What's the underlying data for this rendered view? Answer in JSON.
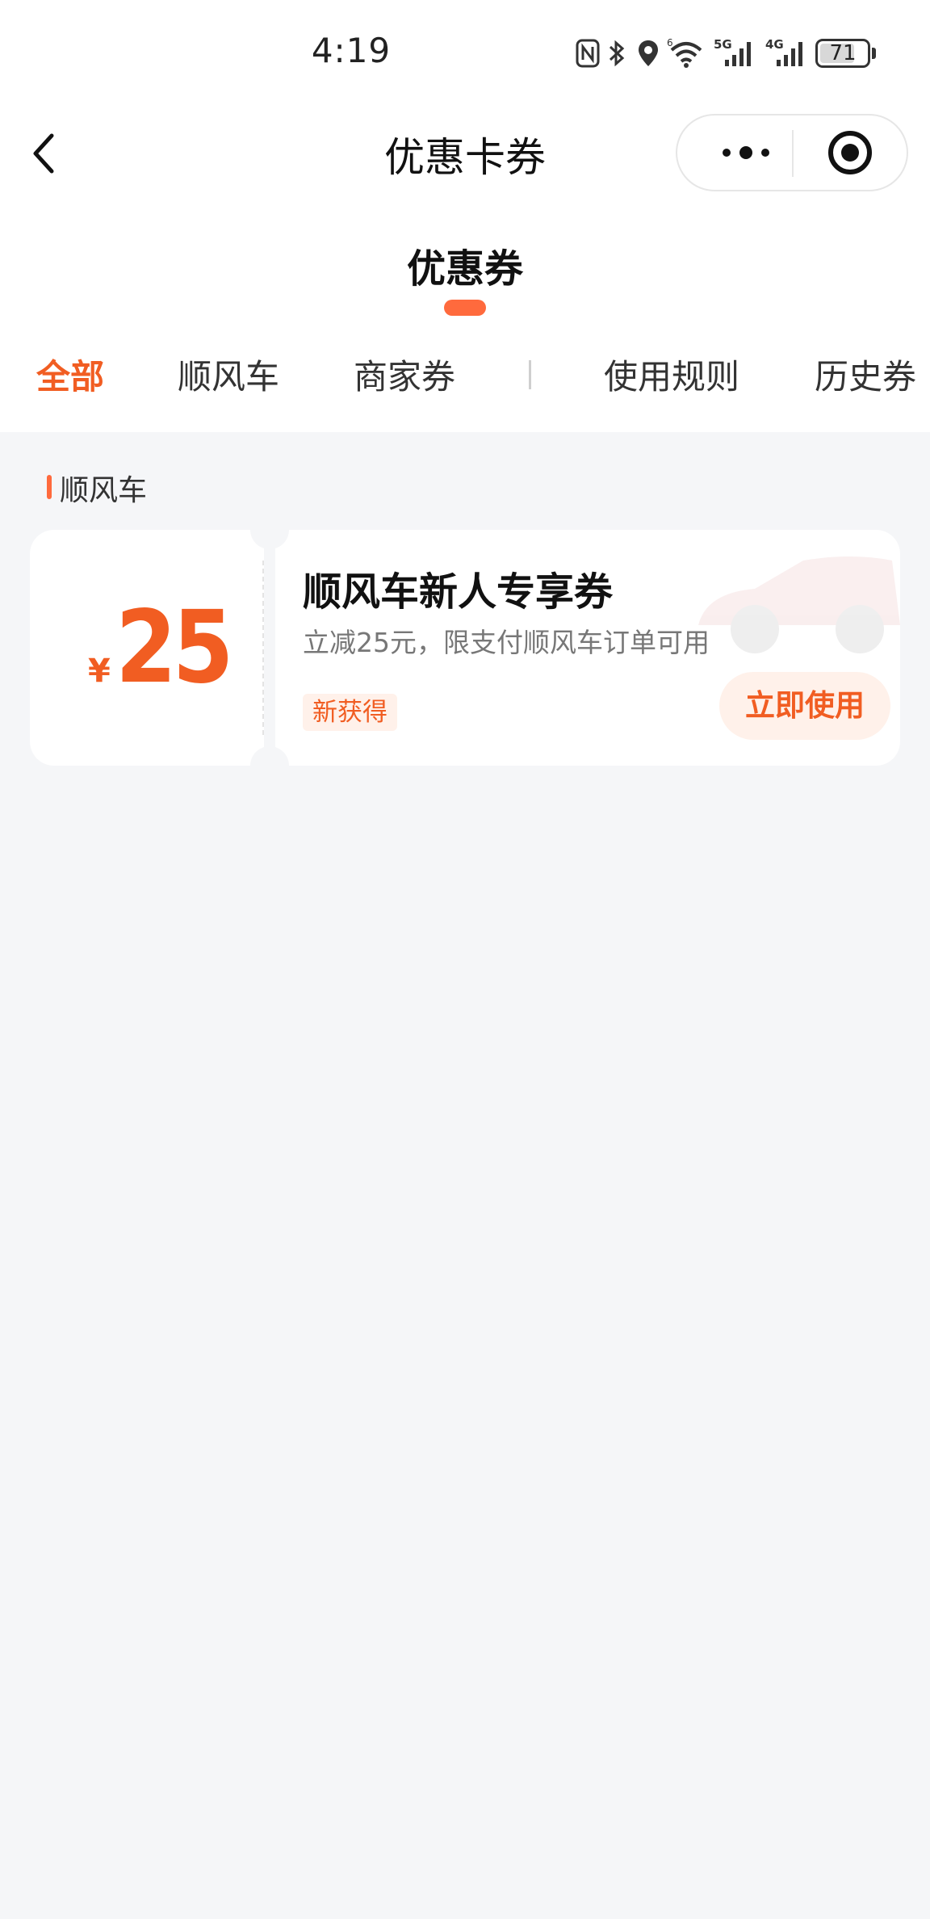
{
  "status_bar": {
    "time": "4:19",
    "battery": "71",
    "network_labels": [
      "5G",
      "4G"
    ],
    "icons": [
      "nfc-icon",
      "bluetooth-icon",
      "location-icon",
      "wifi-icon",
      "signal-5g-icon",
      "signal-4g-icon",
      "battery-icon"
    ]
  },
  "nav": {
    "title": "优惠卡券",
    "back_icon": "chevron-left-icon",
    "more_icon": "more-dots-icon",
    "close_icon": "target-circle-icon"
  },
  "page_tab": {
    "label": "优惠券",
    "accent_color": "#ff6a3d"
  },
  "filters": {
    "active_index": 0,
    "items": [
      {
        "label": "全部"
      },
      {
        "label": "顺风车"
      },
      {
        "label": "商家券"
      },
      {
        "label": "使用规则"
      },
      {
        "label": "历史券"
      }
    ]
  },
  "group": {
    "label": "顺风车"
  },
  "coupons": [
    {
      "currency": "¥",
      "amount": "25",
      "title": "顺风车新人专享券",
      "description": "立减25元，限支付顺风车订单可用",
      "badge": "新获得",
      "action": "立即使用",
      "accent_color": "#f15d22"
    }
  ]
}
